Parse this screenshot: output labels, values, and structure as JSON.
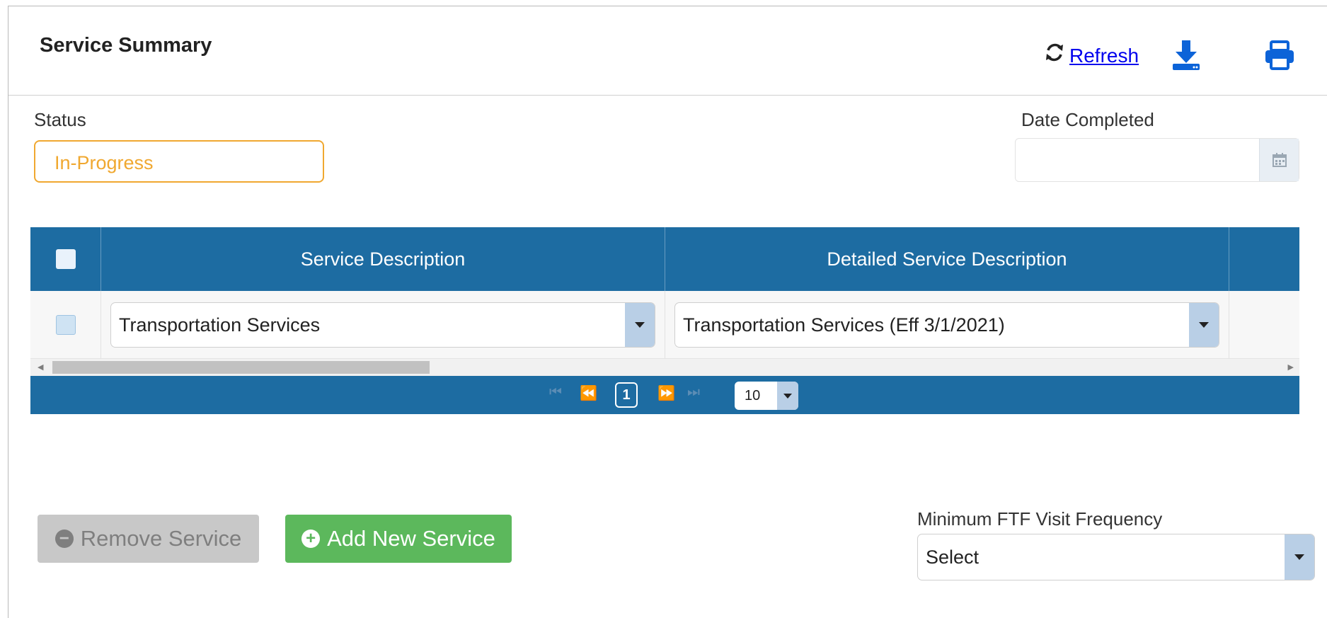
{
  "header": {
    "title": "Service Summary",
    "refresh_label": "Refresh"
  },
  "status": {
    "label": "Status",
    "value": "In-Progress",
    "color": "#f0a830"
  },
  "date_completed": {
    "label": "Date Completed",
    "value": ""
  },
  "grid": {
    "columns": [
      "Service Description",
      "Detailed Service Description"
    ],
    "rows": [
      {
        "service_description": "Transportation Services",
        "detailed_service_description": "Transportation Services (Eff 3/1/2021)"
      }
    ],
    "pager": {
      "current_page": "1",
      "page_size": "10"
    },
    "header_color": "#1d6ca2"
  },
  "actions": {
    "remove_label": "Remove Service",
    "add_label": "Add New Service",
    "add_color": "#5cb85c"
  },
  "ftf": {
    "label": "Minimum FTF Visit Frequency",
    "value": "Select"
  }
}
